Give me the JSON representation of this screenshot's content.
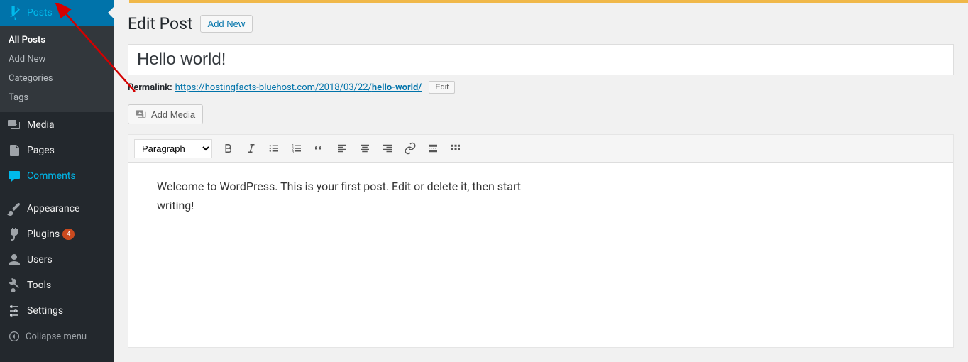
{
  "sidebar": {
    "posts": "Posts",
    "sub": {
      "all_posts": "All Posts",
      "add_new": "Add New",
      "categories": "Categories",
      "tags": "Tags"
    },
    "media": "Media",
    "pages": "Pages",
    "comments": "Comments",
    "appearance": "Appearance",
    "plugins": "Plugins",
    "plugins_badge": "4",
    "users": "Users",
    "tools": "Tools",
    "settings": "Settings",
    "collapse": "Collapse menu"
  },
  "header": {
    "title": "Edit Post",
    "add_new": "Add New"
  },
  "post": {
    "title": "Hello world!",
    "permalink_label": "Permalink:",
    "permalink_base": "https://hostingfacts-bluehost.com/2018/03/22/",
    "permalink_slug": "hello-world/",
    "edit_btn": "Edit"
  },
  "media_btn": "Add Media",
  "editor": {
    "format": "Paragraph",
    "content": "Welcome to WordPress. This is your first post. Edit or delete it, then start writing!"
  }
}
